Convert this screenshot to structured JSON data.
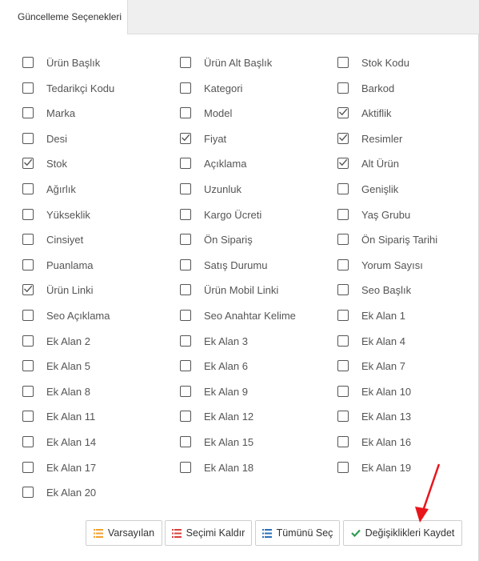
{
  "tab": {
    "label": "Güncelleme Seçenekleri"
  },
  "options": [
    {
      "label": "Ürün Başlık",
      "checked": false
    },
    {
      "label": "Ürün Alt Başlık",
      "checked": false
    },
    {
      "label": "Stok Kodu",
      "checked": false
    },
    {
      "label": "Tedarikçi Kodu",
      "checked": false
    },
    {
      "label": "Kategori",
      "checked": false
    },
    {
      "label": "Barkod",
      "checked": false
    },
    {
      "label": "Marka",
      "checked": false
    },
    {
      "label": "Model",
      "checked": false
    },
    {
      "label": "Aktiflik",
      "checked": true
    },
    {
      "label": "Desi",
      "checked": false
    },
    {
      "label": "Fiyat",
      "checked": true
    },
    {
      "label": "Resimler",
      "checked": true
    },
    {
      "label": "Stok",
      "checked": true
    },
    {
      "label": "Açıklama",
      "checked": false
    },
    {
      "label": "Alt Ürün",
      "checked": true
    },
    {
      "label": "Ağırlık",
      "checked": false
    },
    {
      "label": "Uzunluk",
      "checked": false
    },
    {
      "label": "Genişlik",
      "checked": false
    },
    {
      "label": "Yükseklik",
      "checked": false
    },
    {
      "label": "Kargo Ücreti",
      "checked": false
    },
    {
      "label": "Yaş Grubu",
      "checked": false
    },
    {
      "label": "Cinsiyet",
      "checked": false
    },
    {
      "label": "Ön Sipariş",
      "checked": false
    },
    {
      "label": "Ön Sipariş Tarihi",
      "checked": false
    },
    {
      "label": "Puanlama",
      "checked": false
    },
    {
      "label": "Satış Durumu",
      "checked": false
    },
    {
      "label": "Yorum Sayısı",
      "checked": false
    },
    {
      "label": "Ürün Linki",
      "checked": true
    },
    {
      "label": "Ürün Mobil Linki",
      "checked": false
    },
    {
      "label": "Seo Başlık",
      "checked": false
    },
    {
      "label": "Seo Açıklama",
      "checked": false
    },
    {
      "label": "Seo Anahtar Kelime",
      "checked": false
    },
    {
      "label": "Ek Alan 1",
      "checked": false
    },
    {
      "label": "Ek Alan 2",
      "checked": false
    },
    {
      "label": "Ek Alan 3",
      "checked": false
    },
    {
      "label": "Ek Alan 4",
      "checked": false
    },
    {
      "label": "Ek Alan 5",
      "checked": false
    },
    {
      "label": "Ek Alan 6",
      "checked": false
    },
    {
      "label": "Ek Alan 7",
      "checked": false
    },
    {
      "label": "Ek Alan 8",
      "checked": false
    },
    {
      "label": "Ek Alan 9",
      "checked": false
    },
    {
      "label": "Ek Alan 10",
      "checked": false
    },
    {
      "label": "Ek Alan 11",
      "checked": false
    },
    {
      "label": "Ek Alan 12",
      "checked": false
    },
    {
      "label": "Ek Alan 13",
      "checked": false
    },
    {
      "label": "Ek Alan 14",
      "checked": false
    },
    {
      "label": "Ek Alan 15",
      "checked": false
    },
    {
      "label": "Ek Alan 16",
      "checked": false
    },
    {
      "label": "Ek Alan 17",
      "checked": false
    },
    {
      "label": "Ek Alan 18",
      "checked": false
    },
    {
      "label": "Ek Alan 19",
      "checked": false
    },
    {
      "label": "Ek Alan 20",
      "checked": false
    }
  ],
  "buttons": {
    "defaults": {
      "label": "Varsayılan",
      "icon": "list-icon",
      "icon_color": "#f0a030"
    },
    "clear": {
      "label": "Seçimi Kaldır",
      "icon": "list-icon",
      "icon_color": "#d9403a"
    },
    "select_all": {
      "label": "Tümünü Seç",
      "icon": "list-icon",
      "icon_color": "#2a6fb8"
    },
    "save": {
      "label": "Değişiklikleri Kaydet",
      "icon": "check-icon",
      "icon_color": "#2e9b4f"
    }
  },
  "annotation": {
    "arrow_color": "#e8151b"
  }
}
